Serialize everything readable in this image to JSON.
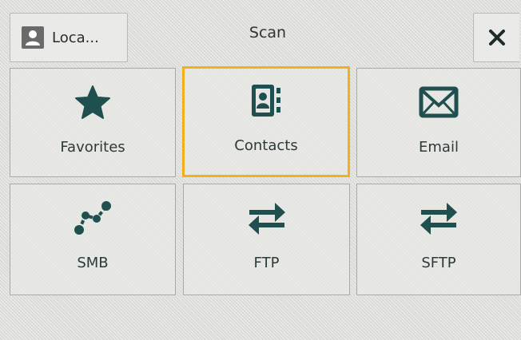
{
  "header": {
    "user_label": "Loca...",
    "title": "Scan",
    "close_glyph": "✕"
  },
  "tiles": [
    {
      "label": "Favorites",
      "icon": "star-icon"
    },
    {
      "label": "Contacts",
      "icon": "address-book-icon",
      "selected": true
    },
    {
      "label": "Email",
      "icon": "envelope-icon"
    },
    {
      "label": "SMB",
      "icon": "network-path-icon"
    },
    {
      "label": "FTP",
      "icon": "transfer-arrows-icon"
    },
    {
      "label": "SFTP",
      "icon": "transfer-arrows-icon"
    }
  ],
  "colors": {
    "icon": "#1f4f4f",
    "selected_border": "#f2b01e",
    "background": "#e2e2df"
  }
}
